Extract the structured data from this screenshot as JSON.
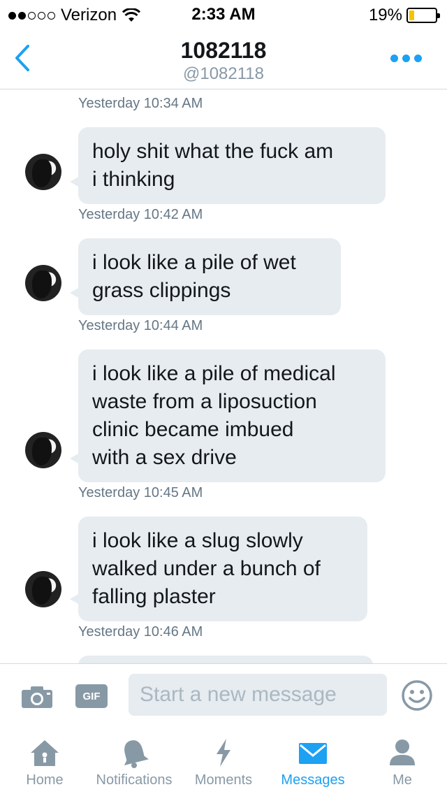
{
  "status_bar": {
    "carrier": "Verizon",
    "signal_bars": 2,
    "signal_total": 5,
    "time": "2:33 AM",
    "battery_percent": "19%",
    "battery_level": 0.19,
    "battery_color": "#f5c400"
  },
  "header": {
    "title": "1082118",
    "handle": "@1082118",
    "back_icon": "chevron-left-icon",
    "more_icon": "ellipsis-icon"
  },
  "messages": [
    {
      "timestamp": "Yesterday 10:34 AM",
      "lines": [
        "holy shit what the fuck am",
        "i thinking"
      ]
    },
    {
      "timestamp": "Yesterday 10:42 AM",
      "lines": [
        "i look like a pile of wet",
        "grass clippings"
      ]
    },
    {
      "timestamp": "Yesterday 10:44 AM",
      "lines": [
        "i look like a pile of medical",
        "waste from a liposuction",
        "clinic became imbued",
        "with a sex drive"
      ]
    },
    {
      "timestamp": "Yesterday 10:45 AM",
      "lines": [
        "i look like a slug slowly",
        "walked under a bunch of",
        "falling plaster"
      ]
    },
    {
      "timestamp": "Yesterday 10:46 AM",
      "lines": []
    }
  ],
  "compose": {
    "placeholder": "Start a new message",
    "gif_label": "GIF",
    "camera_icon": "camera-icon",
    "emoji_icon": "emoji-icon"
  },
  "tabs": [
    {
      "label": "Home",
      "icon": "home-icon",
      "active": false
    },
    {
      "label": "Notifications",
      "icon": "bell-icon",
      "active": false
    },
    {
      "label": "Moments",
      "icon": "lightning-icon",
      "active": false
    },
    {
      "label": "Messages",
      "icon": "envelope-icon",
      "active": true
    },
    {
      "label": "Me",
      "icon": "person-icon",
      "active": false
    }
  ],
  "colors": {
    "accent": "#1da1f2",
    "bubble": "#e6ecf0",
    "inactive": "#8899a6"
  }
}
